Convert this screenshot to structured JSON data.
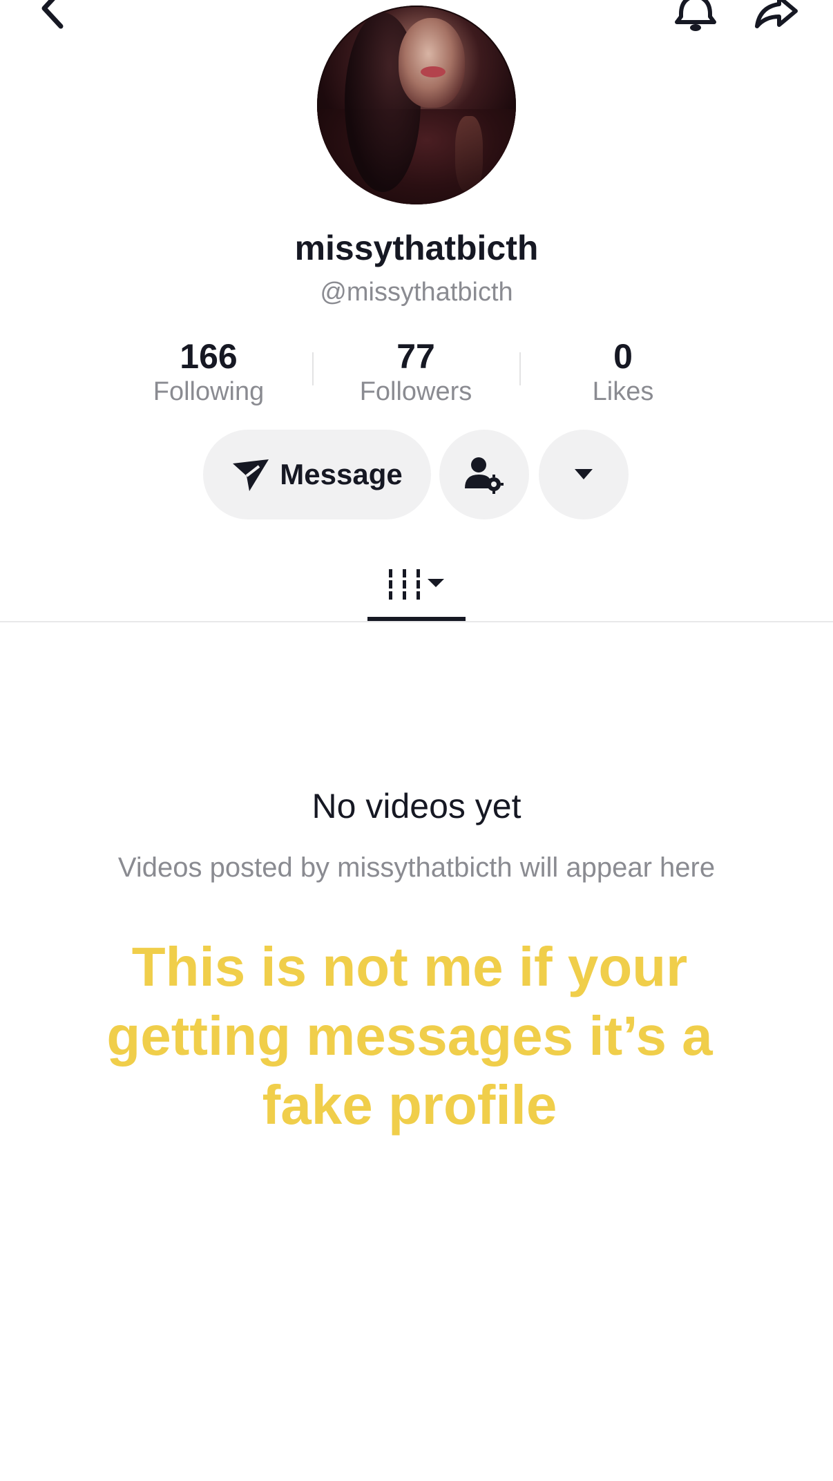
{
  "profile": {
    "display_name": "missythatbicth",
    "handle": "@missythatbicth"
  },
  "stats": {
    "following": {
      "value": "166",
      "label": "Following"
    },
    "followers": {
      "value": "77",
      "label": "Followers"
    },
    "likes": {
      "value": "0",
      "label": "Likes"
    }
  },
  "actions": {
    "message_label": "Message"
  },
  "empty_state": {
    "title": "No videos yet",
    "subtitle": "Videos posted by missythatbicth will appear here"
  },
  "overlay_text": "This is not me if your getting messages it’s a fake profile",
  "icons": {
    "back": "back-arrow-icon",
    "bell": "bell-icon",
    "share": "share-icon",
    "send": "send-icon",
    "follow_settings": "user-settings-icon",
    "dropdown": "caret-down-icon",
    "grid": "video-grid-icon"
  },
  "colors": {
    "text_primary": "#161823",
    "text_secondary": "#8a8b91",
    "button_bg": "#f1f1f2",
    "overlay_yellow": "#f0ce4a"
  }
}
